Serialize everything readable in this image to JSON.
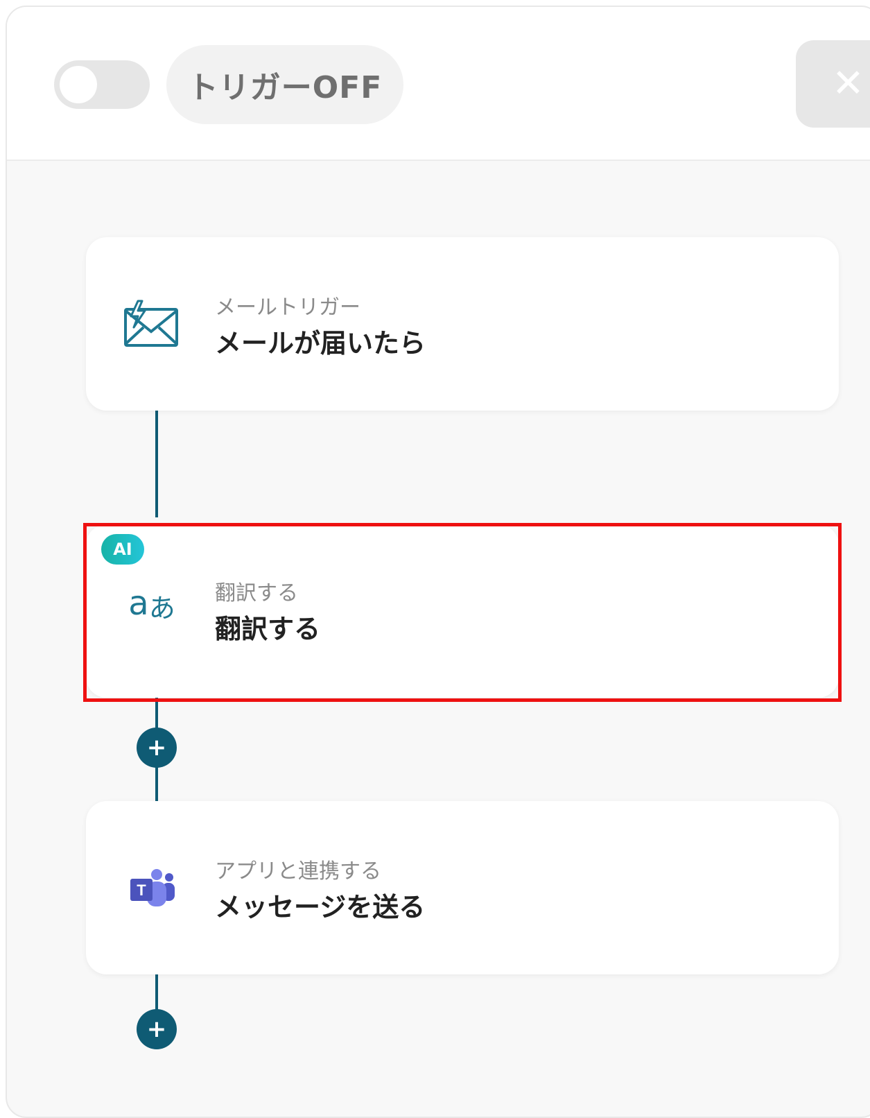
{
  "header": {
    "toggle_state": "off",
    "trigger_status": "トリガーOFF"
  },
  "steps": [
    {
      "label": "メールトリガー",
      "title": "メールが届いたら",
      "icon": "mail-trigger-icon"
    },
    {
      "label": "翻訳する",
      "title": "翻訳する",
      "icon": "translate-icon",
      "badge": "AI"
    },
    {
      "label": "アプリと連携する",
      "title": "メッセージを送る",
      "icon": "microsoft-teams-icon"
    }
  ],
  "colors": {
    "accent": "#0f5b74",
    "highlight": "#ee1111",
    "ai_badge": "#1bbcc0"
  }
}
